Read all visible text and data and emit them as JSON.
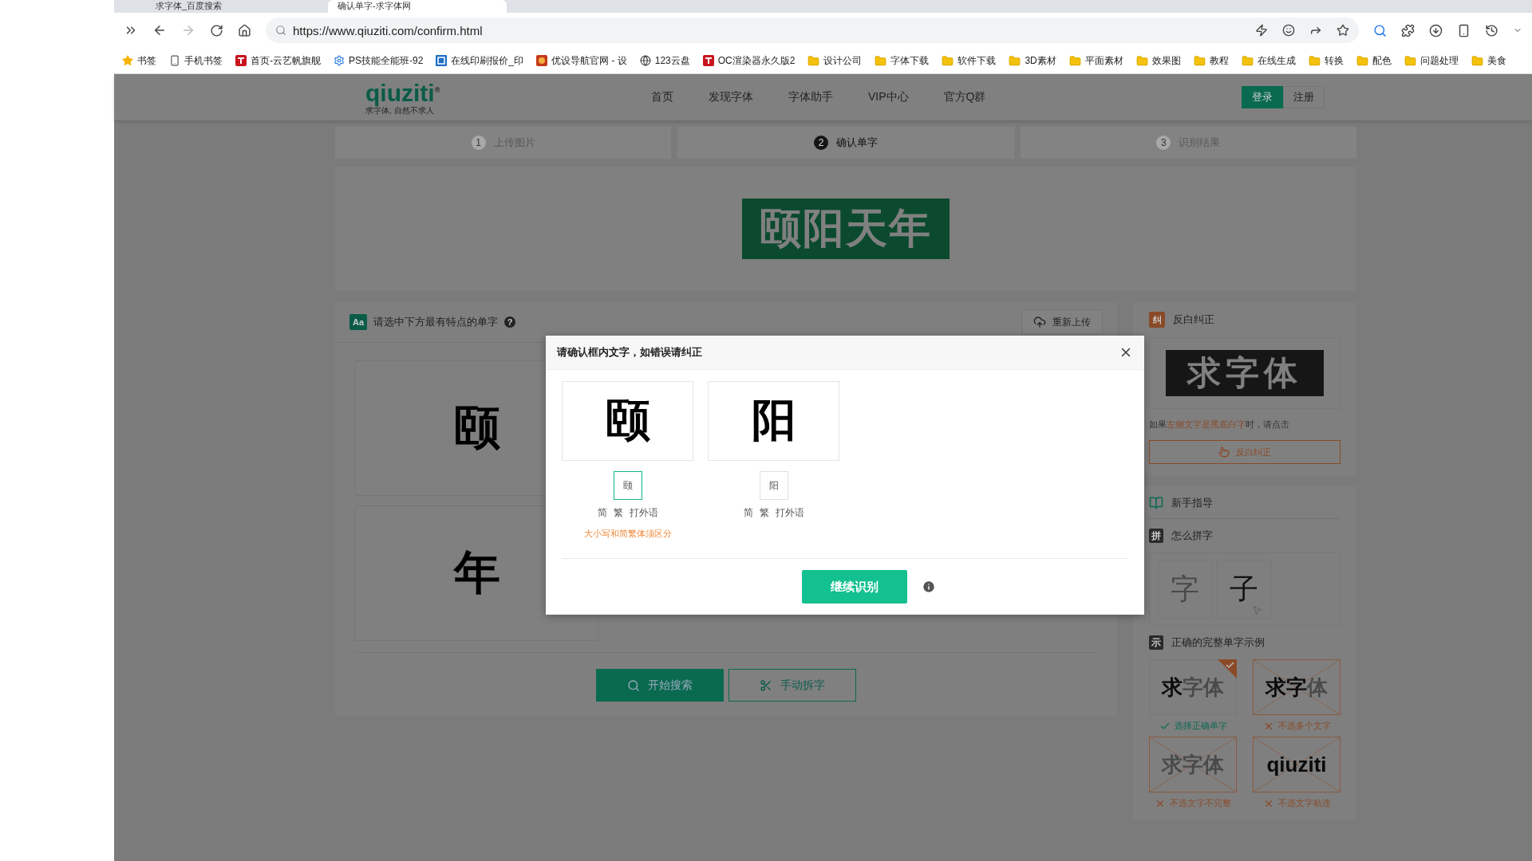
{
  "browser": {
    "tabs": [
      {
        "title": "求字体_百度搜索",
        "selected": false
      },
      {
        "title": "确认单字-求字体网",
        "selected": true
      }
    ],
    "url": "https://www.qiuziti.com/confirm.html",
    "bookmarks": [
      {
        "label": "书签",
        "kind": "star"
      },
      {
        "label": "手机书签",
        "kind": "phone"
      },
      {
        "label": "首页-云艺帆旗舰",
        "kind": "site"
      },
      {
        "label": "PS技能全能班-92",
        "kind": "gear"
      },
      {
        "label": "在线印刷报价_印",
        "kind": "print"
      },
      {
        "label": "优设导航官网 - 设",
        "kind": "avatar"
      },
      {
        "label": "123云盘",
        "kind": "globe"
      },
      {
        "label": "OC渲染器永久版2",
        "kind": "site"
      },
      {
        "label": "设计公司",
        "kind": "folder"
      },
      {
        "label": "字体下载",
        "kind": "folder"
      },
      {
        "label": "软件下载",
        "kind": "folder"
      },
      {
        "label": "3D素材",
        "kind": "folder"
      },
      {
        "label": "平面素材",
        "kind": "folder"
      },
      {
        "label": "效果图",
        "kind": "folder"
      },
      {
        "label": "教程",
        "kind": "folder"
      },
      {
        "label": "在线生成",
        "kind": "folder"
      },
      {
        "label": "转换",
        "kind": "folder"
      },
      {
        "label": "配色",
        "kind": "folder"
      },
      {
        "label": "问题处理",
        "kind": "folder"
      },
      {
        "label": "美食",
        "kind": "folder"
      }
    ]
  },
  "site": {
    "logo": "qiuziti",
    "logo_mark": "®",
    "slogan": "求字体, 自然不求人",
    "nav": [
      "首页",
      "发现字体",
      "字体助手",
      "VIP中心",
      "官方Q群"
    ],
    "login": "登录",
    "register": "注册"
  },
  "steps": [
    {
      "number": "1",
      "label": "上传图片",
      "selected": false
    },
    {
      "number": "2",
      "label": "确认单字",
      "selected": true
    },
    {
      "number": "3",
      "label": "识别结果",
      "selected": false
    }
  ],
  "upload_preview": {
    "text": "颐阳天年"
  },
  "select_panel": {
    "badge": "Aa",
    "title": "请选中下方最有特点的单字",
    "help": "?",
    "reupload": "重新上传",
    "characters": [
      "颐",
      "年"
    ],
    "search_button": "开始搜索",
    "split_button": "手动拆字"
  },
  "sidebar": {
    "invert": {
      "badge": "纠",
      "title": "反白纠正",
      "sample": "求字体",
      "hint": [
        {
          "text": "如果",
          "highlight": false
        },
        {
          "text": "左侧文字是黑底白字",
          "highlight": true
        },
        {
          "text": "时，请点击",
          "highlight": false
        }
      ],
      "button": "反白纠正"
    },
    "guide": {
      "title": "新手指导"
    },
    "compose": {
      "badge": "拼",
      "title": "怎么拼字",
      "tiles": [
        {
          "glyph": "字",
          "faded": true
        },
        {
          "glyph": "子",
          "faded": false
        }
      ]
    },
    "examples": {
      "badge": "示",
      "title": "正确的完整单字示例",
      "items": [
        {
          "parts": [
            {
              "text": "求",
              "dark": true
            },
            {
              "text": "字体",
              "dark": false
            }
          ],
          "correct": true,
          "caption": "选择正确单字"
        },
        {
          "parts": [
            {
              "text": "求字",
              "dark": true
            },
            {
              "text": "体",
              "dark": false
            }
          ],
          "correct": false,
          "caption": "不选多个文字"
        },
        {
          "parts": [
            {
              "text": "求字体",
              "dark": false
            }
          ],
          "correct": false,
          "caption": "不选文字不完整"
        },
        {
          "parts": [
            {
              "text": "qiuziti",
              "dark": true
            }
          ],
          "correct": false,
          "caption": "不选文字粘连"
        }
      ]
    }
  },
  "dialog": {
    "title": "请确认框内文字，如错误请纠正",
    "items": [
      {
        "glyph": "颐",
        "value": "颐",
        "focused": true,
        "options": [
          "简",
          "繁",
          "打外语"
        ],
        "note": "大小写和简繁体须区分"
      },
      {
        "glyph": "阳",
        "value": "阳",
        "focused": false,
        "options": [
          "简",
          "繁",
          "打外语"
        ]
      }
    ],
    "button": "继续识别"
  }
}
